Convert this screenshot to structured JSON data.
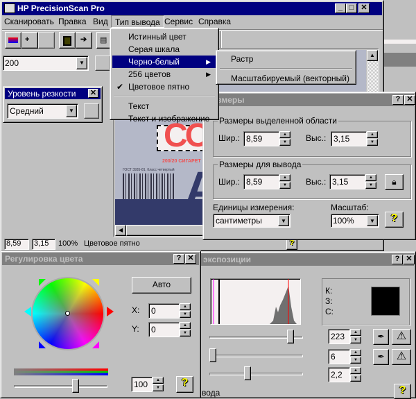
{
  "app": {
    "title": "HP PrecisionScan Pro"
  },
  "menubar": [
    "Сканировать",
    "Правка",
    "Вид",
    "Тип вывода",
    "Сервис",
    "Справка"
  ],
  "output_menu": {
    "items": [
      {
        "label": "Истинный цвет"
      },
      {
        "label": "Серая шкала"
      },
      {
        "label": "Черно-белый",
        "submenu": true,
        "highlighted": true
      },
      {
        "label": "256 цветов",
        "submenu": true
      },
      {
        "label": "Цветовое пятно",
        "checked": true
      },
      {
        "label": "Текст"
      },
      {
        "label": "Текст и изображение"
      }
    ],
    "check_glyph": "✔",
    "arrow_glyph": "▶",
    "submenu": [
      "Растр",
      "Масштабируемый (векторный)"
    ]
  },
  "toolbar": {
    "resolution": "200"
  },
  "sharpness": {
    "title": "Уровень резкости",
    "value": "Средний"
  },
  "preview": {
    "logo_text": "CO",
    "sub_text": "200/20 СИГАРЕТ",
    "barcode_text": "ГОСТ 3935-81, Класс четвертый",
    "big_letter": "A"
  },
  "statusbar": {
    "width": "8,59",
    "height": "3,15",
    "scale": "100%",
    "mode": "Цветовое пятно",
    "help": "?"
  },
  "dimensions": {
    "title": "Размеры",
    "sel_group": "Размеры выделенной области",
    "out_group": "Размеры для вывода",
    "w_label": "Шир.:",
    "h_label": "Выс.:",
    "sel_w": "8,59",
    "sel_h": "3,15",
    "out_w": "8,59",
    "out_h": "3,15",
    "units_label": "Единицы измерения:",
    "units": "сантиметры",
    "scale_label": "Масштаб:",
    "scale": "100%",
    "help": "?"
  },
  "color": {
    "title": "Регулировка цвета",
    "auto": "Авто",
    "x_label": "X:",
    "y_label": "Y:",
    "x": "0",
    "y": "0",
    "saturation": "100",
    "saturation_pct": 0.66,
    "help": "?"
  },
  "exposure": {
    "title": "экспозиции",
    "k_label": "К:",
    "z_label": "З:",
    "c_label": "С:",
    "highlight": "223",
    "shadow": "6",
    "gamma": "2,2",
    "highlight_frac": 0.87,
    "shadow_frac": 0.04,
    "gamma_frac": 0.41,
    "footer": "вода",
    "help": "?"
  },
  "window_buttons": {
    "min": "_",
    "max": "□",
    "close": "✕",
    "help": "?"
  }
}
